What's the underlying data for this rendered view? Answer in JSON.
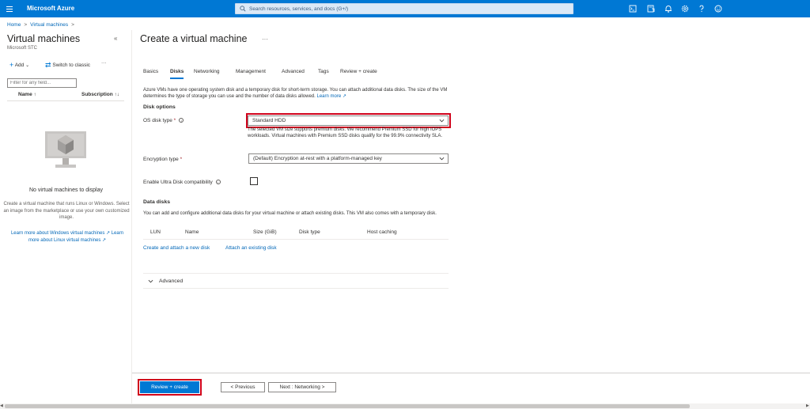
{
  "app": {
    "brand": "Microsoft Azure"
  },
  "search": {
    "placeholder": "Search resources, services, and docs (G+/)"
  },
  "topbar_icons": [
    "cloud-shell-icon",
    "directory-filter-icon",
    "notifications-icon",
    "settings-icon",
    "help-icon",
    "feedback-icon"
  ],
  "breadcrumb": {
    "items": [
      "Home",
      "Virtual machines"
    ]
  },
  "left_pane": {
    "title": "Virtual machines",
    "subtitle": "Microsoft STC",
    "toolbar": {
      "add": "Add",
      "switch": "Switch to classic",
      "more": "···"
    },
    "filter_placeholder": "Filter for any field...",
    "columns": {
      "name": "Name ↑",
      "subscription": "Subscription ↑↓"
    },
    "empty_title": "No virtual machines to display",
    "empty_desc": "Create a virtual machine that runs Linux or Windows. Select an image from the marketplace or use your own customized image.",
    "link_windows": "Learn more about Windows virtual machines",
    "link_linux_a": "Learn",
    "link_linux_b": "more about Linux virtual machines"
  },
  "main": {
    "title": "Create a virtual machine",
    "more": "···",
    "tabs": [
      "Basics",
      "Disks",
      "Networking",
      "Management",
      "Advanced",
      "Tags",
      "Review + create"
    ],
    "active_tab": "Disks",
    "intro": "Azure VMs have one operating system disk and a temporary disk for short-term storage. You can attach additional data disks. The size of the VM determines the type of storage you can use and the number of data disks allowed.",
    "learn_more": "Learn more",
    "disk_options_heading": "Disk options",
    "os_disk_label": "OS disk type",
    "os_disk_value": "Standard HDD",
    "os_disk_hint": "The selected VM size supports premium disks. We recommend Premium SSD for high IOPS workloads. Virtual machines with Premium SSD disks qualify for the 99.9% connectivity SLA.",
    "encryption_label": "Encryption type",
    "encryption_value": "(Default) Encryption at-rest with a platform-managed key",
    "ultra_label": "Enable Ultra Disk compatibility",
    "ultra_checked": false,
    "data_disks_heading": "Data disks",
    "data_disks_desc": "You can add and configure additional data disks for your virtual machine or attach existing disks. This VM also comes with a temporary disk.",
    "data_disks_columns": [
      "LUN",
      "Name",
      "Size (GiB)",
      "Disk type",
      "Host caching"
    ],
    "create_attach": "Create and attach a new disk",
    "attach_existing": "Attach an existing disk",
    "advanced_label": "Advanced"
  },
  "footer": {
    "review_create": "Review + create",
    "previous": "< Previous",
    "next": "Next : Networking >"
  },
  "colors": {
    "accent": "#0078d4",
    "highlight": "#d0021b",
    "link": "#0067b8"
  }
}
